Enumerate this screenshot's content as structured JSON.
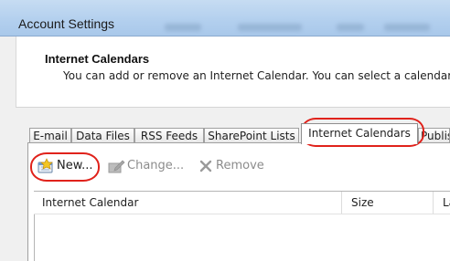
{
  "window": {
    "title": "Account Settings"
  },
  "header": {
    "heading": "Internet Calendars",
    "description": "You can add or remove an Internet Calendar. You can select a calendar a"
  },
  "tabs": [
    {
      "label": "E-mail"
    },
    {
      "label": "Data Files"
    },
    {
      "label": "RSS Feeds"
    },
    {
      "label": "SharePoint Lists"
    },
    {
      "label": "Internet Calendars",
      "active": true
    },
    {
      "label": "Publis"
    }
  ],
  "toolbar": {
    "new_label": "New...",
    "change_label": "Change...",
    "remove_label": "Remove"
  },
  "list": {
    "columns": [
      "Internet Calendar",
      "Size",
      "La"
    ]
  },
  "colors": {
    "titlebar": "#b2cfee",
    "annotation": "#e0221b",
    "disabled_text": "#8c8c8c"
  }
}
